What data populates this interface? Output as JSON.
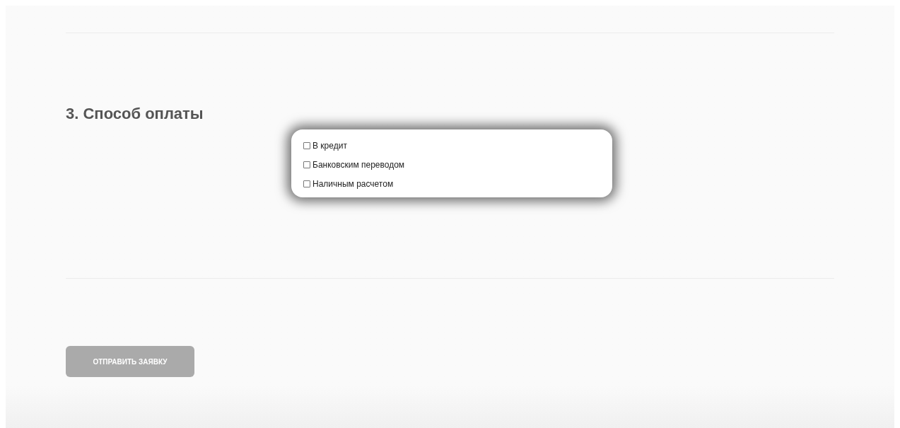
{
  "section": {
    "title": "3. Способ оплаты"
  },
  "options": [
    {
      "label": "В кредит",
      "checked": false
    },
    {
      "label": "Банковским переводом",
      "checked": false
    },
    {
      "label": "Наличным расчетом",
      "checked": false
    }
  ],
  "submit": {
    "label": "ОТПРАВИТЬ ЗАЯВКУ",
    "disabled": true
  }
}
